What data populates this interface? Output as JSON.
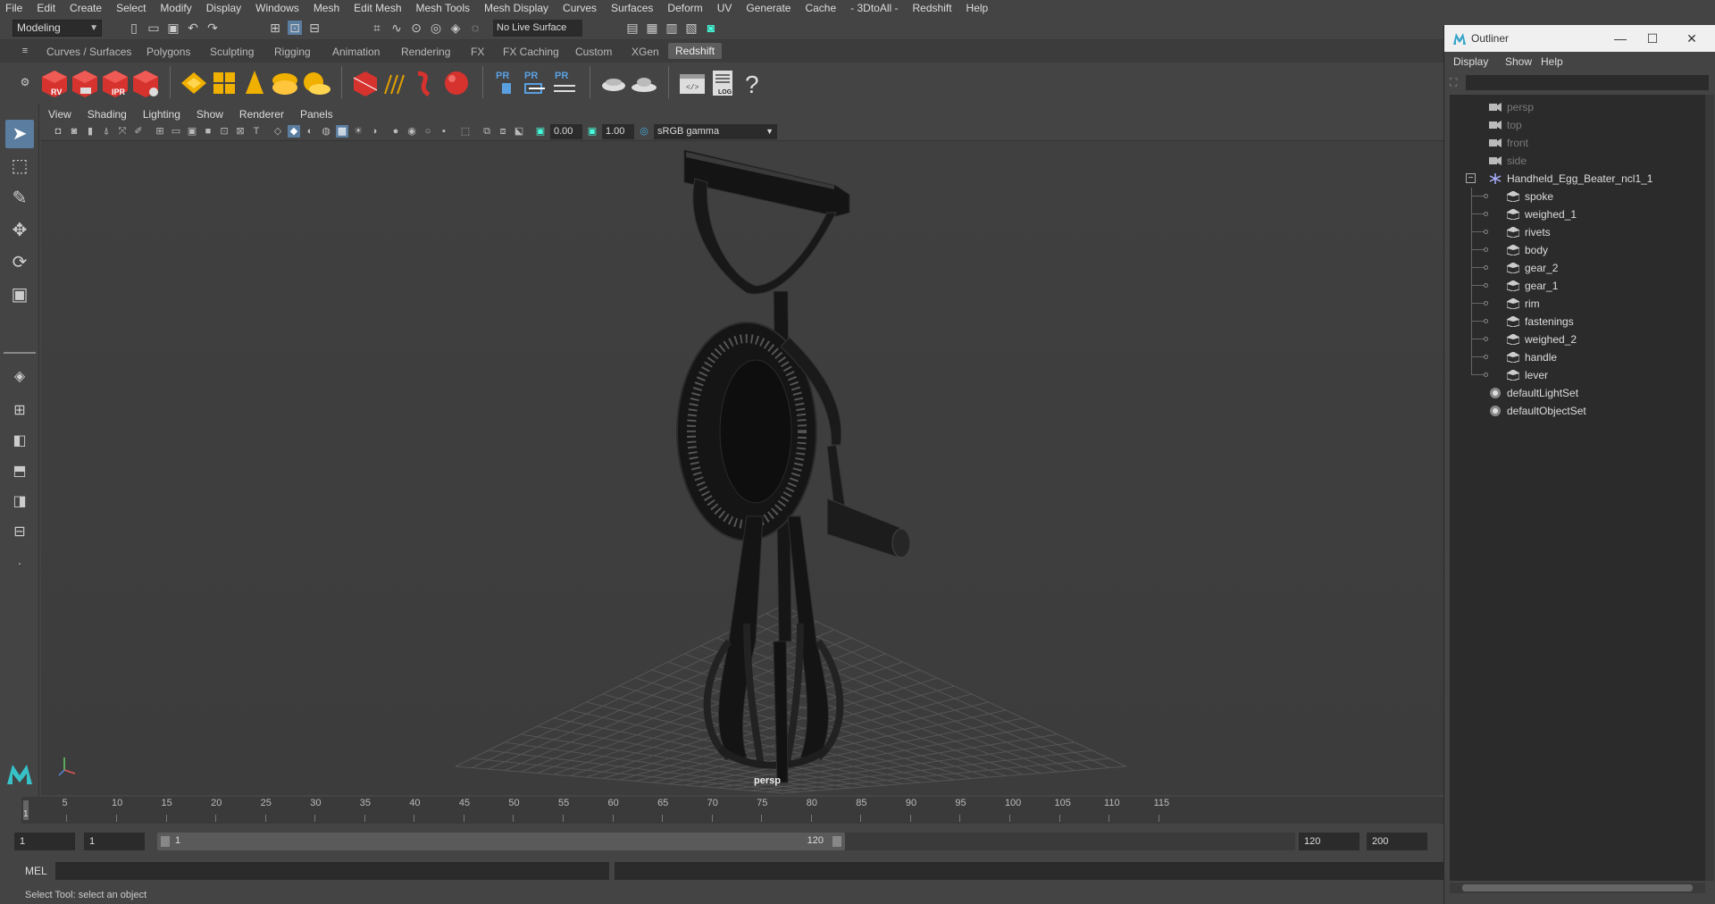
{
  "menubar": {
    "items": [
      "File",
      "Edit",
      "Create",
      "Select",
      "Modify",
      "Display",
      "Windows",
      "Mesh",
      "Edit Mesh",
      "Mesh Tools",
      "Mesh Display",
      "Curves",
      "Surfaces",
      "Deform",
      "UV",
      "Generate",
      "Cache",
      "- 3DtoAll -",
      "Redshift",
      "Help"
    ]
  },
  "statusline": {
    "mode": "Modeling",
    "live_surface": "No Live Surface"
  },
  "shelf": {
    "tabs": [
      "Curves / Surfaces",
      "Polygons",
      "Sculpting",
      "Rigging",
      "Animation",
      "Rendering",
      "FX",
      "FX Caching",
      "Custom",
      "XGen",
      "Redshift"
    ],
    "active_tab": "Redshift",
    "icons": [
      "RV",
      "",
      "IPR",
      "",
      "",
      "",
      "",
      "",
      "",
      "",
      "",
      "",
      "",
      "PR",
      "PR",
      "PR",
      "",
      "",
      "",
      "LOG",
      "?"
    ]
  },
  "panel": {
    "menu": [
      "View",
      "Shading",
      "Lighting",
      "Show",
      "Renderer",
      "Panels"
    ],
    "exposure": "0.00",
    "gamma": "1.00",
    "color_space": "sRGB gamma",
    "camera": "persp"
  },
  "timeslider": {
    "current_frame": "1",
    "ticks": [
      "5",
      "10",
      "15",
      "20",
      "25",
      "30",
      "35",
      "40",
      "45",
      "50",
      "55",
      "60",
      "65",
      "70",
      "75",
      "80",
      "85",
      "90",
      "95",
      "100",
      "105",
      "110",
      "115"
    ]
  },
  "rangeslider": {
    "start": "1",
    "playback_start": "1",
    "range_start": "1",
    "range_end": "120",
    "playback_end": "120",
    "end": "200"
  },
  "cmdline": {
    "label": "MEL",
    "help": "Select Tool: select an object"
  },
  "outliner": {
    "title": "Outliner",
    "menu": [
      "Display",
      "Show",
      "Help"
    ],
    "cameras": [
      "persp",
      "top",
      "front",
      "side"
    ],
    "group": "Handheld_Egg_Beater_ncl1_1",
    "children": [
      "spoke",
      "weighed_1",
      "rivets",
      "body",
      "gear_2",
      "gear_1",
      "rim",
      "fastenings",
      "weighed_2",
      "handle",
      "lever"
    ],
    "sets": [
      "defaultLightSet",
      "defaultObjectSet"
    ]
  }
}
